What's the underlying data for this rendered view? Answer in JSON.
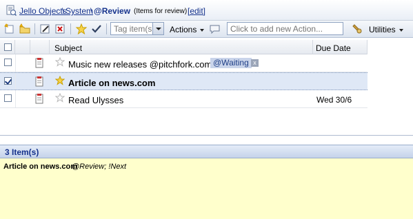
{
  "breadcrumb": {
    "root": "Jello Objects",
    "sep1": "\\",
    "system": "System",
    "sep2": "\\",
    "current": "@Review",
    "subtitle": "(Items for review)",
    "edit": "[edit]"
  },
  "toolbar": {
    "tag_placeholder": "Tag item(s)",
    "actions_label": "Actions",
    "new_action_placeholder": "Click to add new Action...",
    "utilities_label": "Utilities"
  },
  "grid": {
    "columns": {
      "subject": "Subject",
      "due_date": "Due Date"
    },
    "rows": [
      {
        "subject": "Music new releases @pitchfork.com",
        "tag": "@Waiting",
        "tag_remove": "x",
        "due": "",
        "checked": false,
        "selected": false
      },
      {
        "subject": "Article on news.com",
        "tag": "",
        "due": "",
        "checked": true,
        "selected": true
      },
      {
        "subject": "Read Ulysses",
        "tag": "",
        "due": "Wed 30/6",
        "checked": false,
        "selected": false
      }
    ]
  },
  "bottom": {
    "count_label": "3 Item(s)",
    "detail_title": "Article on news.com",
    "detail_tags": "@Review; !Next"
  },
  "colors": {
    "link": "#15328c",
    "selected_row": "#dfe8f6",
    "detail_bg": "#ffffcc",
    "tag_chip": "#c9d4ea"
  }
}
